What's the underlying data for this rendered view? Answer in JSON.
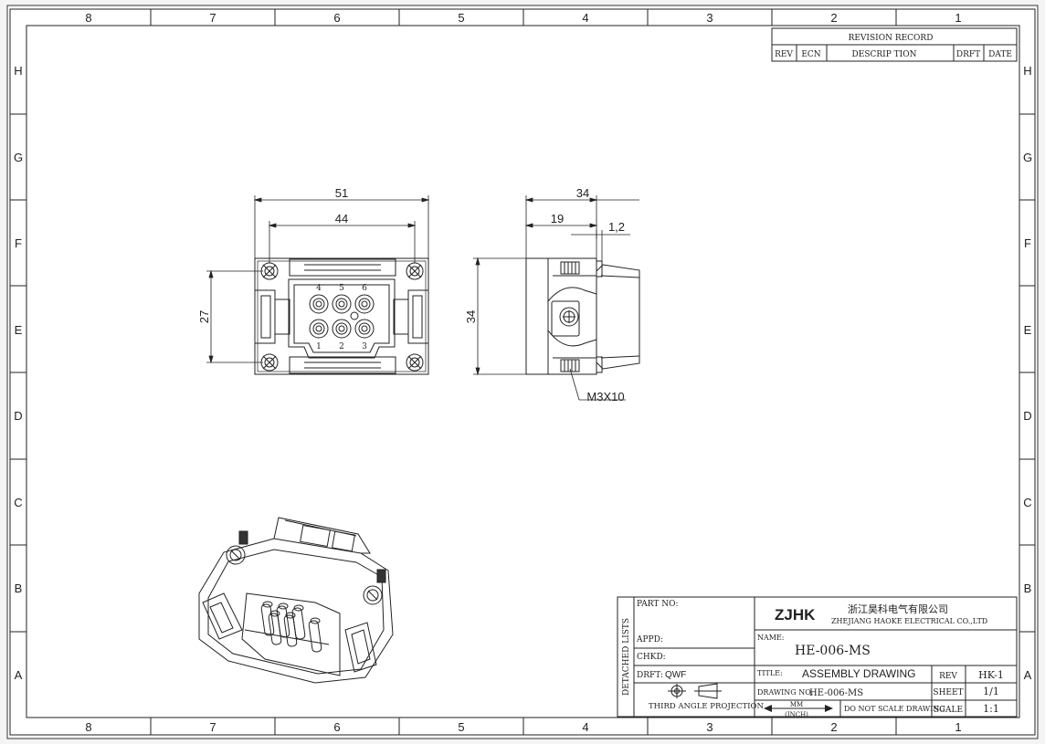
{
  "frame": {
    "columns": [
      "8",
      "7",
      "6",
      "5",
      "4",
      "3",
      "2",
      "1"
    ],
    "rows": [
      "H",
      "G",
      "F",
      "E",
      "D",
      "C",
      "B",
      "A"
    ]
  },
  "revision": {
    "title": "REVISION RECORD",
    "headers": [
      "REV",
      "ECN",
      "DESCRIP TION",
      "DRFT",
      "DATE"
    ]
  },
  "front_view": {
    "dim_width_outer": "51",
    "dim_width_holes": "44",
    "dim_height": "27",
    "pins_top": [
      "4",
      "5",
      "6"
    ],
    "pins_bottom": [
      "1",
      "2",
      "3"
    ]
  },
  "side_view": {
    "dim_width": "34",
    "dim_part": "19",
    "dim_small": "1,2",
    "dim_height": "34",
    "screw_label": "M3X10"
  },
  "title_block": {
    "detached_lists": "DETACHED LISTS",
    "part_no_label": "PART NO:",
    "appd_label": "APPD:",
    "chkd_label": "CHKD:",
    "drft_label": "DRFT:",
    "drft_value": "QWF",
    "projection_label": "THIRD ANGLE PROJECTION",
    "logo": "ZJHK",
    "company_cn": "浙江昊科电气有限公司",
    "company_en": "ZHEJIANG HAOKE ELECTRICAL CO.,LTD",
    "name_label": "NAME:",
    "name_value": "HE-006-MS",
    "title_label": "TITLE:",
    "title_value": "ASSEMBLY DRAWING",
    "drawing_no_label": "DRAWING NO:",
    "drawing_no_value": "HE-006-MS",
    "units_mm": "MM",
    "units_inch": "(INCH)",
    "no_scale": "DO NOT SCALE DRAWING",
    "rev_label": "REV",
    "rev_value": "HK-1",
    "sheet_label": "SHEET",
    "sheet_value": "1/1",
    "scale_label": "SCALE",
    "scale_value": "1:1"
  }
}
